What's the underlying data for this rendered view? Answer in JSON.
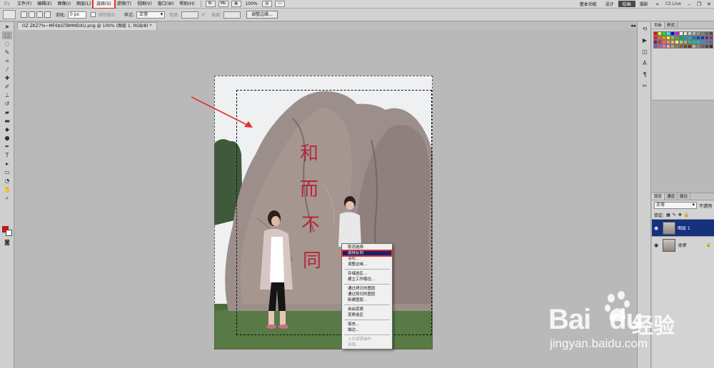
{
  "app": {
    "logo": "Ps"
  },
  "menubar": {
    "items": [
      "文件(F)",
      "编辑(E)",
      "图像(I)",
      "图层(L)",
      "选择(S)",
      "滤镜(T)",
      "视图(V)",
      "窗口(W)",
      "帮助(H)"
    ],
    "active_index": 4,
    "zoom": "100%",
    "workspaces": [
      "基本功能",
      "设计",
      "绘画",
      "摄影"
    ],
    "selected_workspace_index": 2,
    "cs_live": "CS Live"
  },
  "options": {
    "feather_label": "羽化:",
    "feather_value": "0 px",
    "antialias_label": "消除锯齿",
    "style_label": "样式:",
    "style_value": "正常",
    "width_label": "宽度:",
    "height_label": "高度:",
    "refine_edge_button": "调整边缘..."
  },
  "document": {
    "tab_title": "OZ ZKZ7%~MF6$GTBMMDXU.png @ 100% (图层 1, RGB/8) *"
  },
  "context_menu": {
    "items": [
      {
        "label": "取消选择",
        "state": "normal"
      },
      {
        "label": "选择反向",
        "state": "highlighted"
      },
      {
        "label": "羽化...",
        "state": "normal"
      },
      {
        "label": "调整边缘...",
        "state": "normal"
      },
      {
        "label": "",
        "state": "separator"
      },
      {
        "label": "存储选区...",
        "state": "normal"
      },
      {
        "label": "建立工作路径...",
        "state": "normal"
      },
      {
        "label": "",
        "state": "separator"
      },
      {
        "label": "通过拷贝的图层",
        "state": "normal"
      },
      {
        "label": "通过剪切的图层",
        "state": "normal"
      },
      {
        "label": "新建图层...",
        "state": "normal"
      },
      {
        "label": "",
        "state": "separator"
      },
      {
        "label": "自由变换",
        "state": "normal"
      },
      {
        "label": "变换选区",
        "state": "normal"
      },
      {
        "label": "",
        "state": "separator"
      },
      {
        "label": "填充...",
        "state": "normal"
      },
      {
        "label": "描边...",
        "state": "normal"
      },
      {
        "label": "",
        "state": "separator"
      },
      {
        "label": "上次滤镜操作",
        "state": "disabled"
      },
      {
        "label": "渐隐...",
        "state": "disabled"
      }
    ]
  },
  "swatches_panel": {
    "tabs": [
      "色板",
      "样式"
    ],
    "colors": [
      "#ff0000",
      "#ffff00",
      "#00ff00",
      "#00ffff",
      "#0000ff",
      "#ff00ff",
      "#ffffff",
      "#e6e6e6",
      "#cccccc",
      "#b3b3b3",
      "#999999",
      "#808080",
      "#666666",
      "#4d4d4d",
      "#ed1c24",
      "#f26522",
      "#f7941d",
      "#fff200",
      "#8dc63f",
      "#39b54a",
      "#00a651",
      "#00a99d",
      "#00aeef",
      "#0072bc",
      "#0054a6",
      "#2e3192",
      "#662d91",
      "#92278f",
      "#9e005d",
      "#ed145b",
      "#f26c4f",
      "#f68e56",
      "#fbaf5d",
      "#fff568",
      "#acd373",
      "#7cc576",
      "#3cb878",
      "#1cbbb4",
      "#00bff3",
      "#448ccb",
      "#5674b9",
      "#605ca8",
      "#855fa8",
      "#a864a8",
      "#f06eaa",
      "#f49ac1",
      "#c69c6d",
      "#a67c52",
      "#8c6239",
      "#754c24",
      "#603913",
      "#c7b299",
      "#998675",
      "#736357",
      "#534741",
      "#362f2d"
    ]
  },
  "layers_panel": {
    "tabs": [
      "图层",
      "通道",
      "路径"
    ],
    "blend_mode": "正常",
    "opacity_label": "不透明",
    "lock_label": "锁定:",
    "layers": [
      {
        "name": "图层 1",
        "selected": true
      },
      {
        "name": "背景",
        "selected": false
      }
    ]
  },
  "watermark": {
    "brand": "Bai",
    "brand_suffix": "du",
    "cn": "经验",
    "url": "jingyan.baidu.com"
  },
  "photo_text": "和而不同",
  "colors": {
    "highlight": "#11246b",
    "annotation_red": "#e03030",
    "foreground": "#ff0000",
    "background": "#ffffff"
  }
}
